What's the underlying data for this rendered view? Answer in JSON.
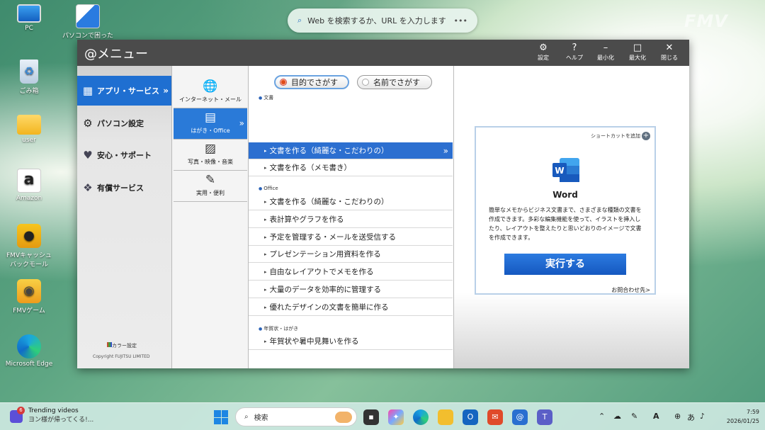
{
  "desktop": {
    "icons": [
      {
        "label": "PC",
        "icon": "pc-icon"
      },
      {
        "label": "パソコンで困ったら",
        "icon": "help-shortcut-icon"
      },
      {
        "label": "ごみ箱",
        "icon": "recycle-bin-icon"
      },
      {
        "label": "user",
        "icon": "folder-icon"
      },
      {
        "label": "Amazon",
        "icon": "amazon-icon"
      },
      {
        "label": "FMVキャッシュバックモール",
        "icon": "cashback-piggy-icon"
      },
      {
        "label": "FMVゲーム",
        "icon": "game-controller-icon"
      },
      {
        "label": "Microsoft Edge",
        "icon": "edge-icon"
      }
    ],
    "web_search_placeholder": "Web を検索するか、URL を入力します",
    "web_search_more": "•••",
    "brand_watermark": "FMV"
  },
  "window": {
    "title": "@メニュー",
    "buttons": {
      "settings": "設定",
      "help": "ヘルプ",
      "minimize": "最小化",
      "maximize": "最大化",
      "close": "閉じる"
    },
    "categories": [
      {
        "label": "アプリ・サービス",
        "icon": "grid-icon",
        "active": true
      },
      {
        "label": "パソコン設定",
        "icon": "gear-icon"
      },
      {
        "label": "安心・サポート",
        "icon": "heart-icon"
      },
      {
        "label": "有償サービス",
        "icon": "paid-service-icon"
      }
    ],
    "color_setting": "カラー設定",
    "copyright": "Copyright FUJITSU LIMITED",
    "subcategories": [
      {
        "label": "インターネット・メール",
        "icon": "globe-mail-icon"
      },
      {
        "label": "はがき・Office",
        "icon": "document-icon",
        "active": true
      },
      {
        "label": "写真・映像・音楽",
        "icon": "photo-music-icon"
      },
      {
        "label": "実用・便利",
        "icon": "keyboard-pen-icon"
      }
    ],
    "search_modes": {
      "purpose": "目的でさがす",
      "name": "名前でさがす",
      "selected": "purpose"
    },
    "sections": [
      {
        "title": "文書",
        "items": [
          "文書を作る（綺麗な・こだわりの）",
          "文書を作る（メモ書き）"
        ]
      },
      {
        "title": "Office",
        "items": [
          "文書を作る（綺麗な・こだわりの）",
          "表計算やグラフを作る",
          "予定を管理する・メールを送受信する",
          "プレゼンテーション用資料を作る",
          "自由なレイアウトでメモを作る",
          "大量のデータを効率的に管理する",
          "優れたデザインの文書を簡単に作る"
        ]
      },
      {
        "title": "年賀状・はがき",
        "items": [
          "年賀状や暑中見舞いを作る"
        ]
      }
    ],
    "detail": {
      "shortcut_label": "ショートカットを追加",
      "app_name": "Word",
      "description": "簡単なメモからビジネス文書まで、さまざまな種類の文書を作成できます。多彩な編集機能を使って、イラストを挿入したり、レイアウトを整えたりと思いどおりのイメージで文書を作成できます。",
      "run_button": "実行する",
      "inquiry_link": "お問合わせ先>"
    }
  },
  "taskbar": {
    "news_title": "Trending videos",
    "news_subtitle": "ヨン様が帰ってくる!...",
    "news_badge": "6",
    "search_placeholder": "検索",
    "time": "7:59",
    "date": "2026/01/25",
    "ime": "A",
    "ime_mode": "あ"
  },
  "colors": {
    "accent": "#1f6fd1",
    "titlebar": "#4b4b4b",
    "run_button": "#1a62c8"
  }
}
